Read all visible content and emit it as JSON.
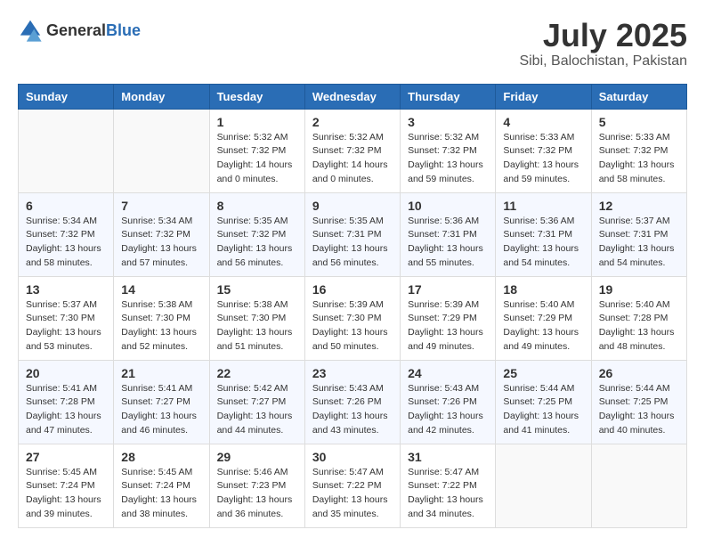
{
  "header": {
    "logo_general": "General",
    "logo_blue": "Blue",
    "month_title": "July 2025",
    "location": "Sibi, Balochistan, Pakistan"
  },
  "weekdays": [
    "Sunday",
    "Monday",
    "Tuesday",
    "Wednesday",
    "Thursday",
    "Friday",
    "Saturday"
  ],
  "weeks": [
    [
      {
        "day": "",
        "empty": true
      },
      {
        "day": "",
        "empty": true
      },
      {
        "day": "1",
        "sunrise": "Sunrise: 5:32 AM",
        "sunset": "Sunset: 7:32 PM",
        "daylight": "Daylight: 14 hours and 0 minutes."
      },
      {
        "day": "2",
        "sunrise": "Sunrise: 5:32 AM",
        "sunset": "Sunset: 7:32 PM",
        "daylight": "Daylight: 14 hours and 0 minutes."
      },
      {
        "day": "3",
        "sunrise": "Sunrise: 5:32 AM",
        "sunset": "Sunset: 7:32 PM",
        "daylight": "Daylight: 13 hours and 59 minutes."
      },
      {
        "day": "4",
        "sunrise": "Sunrise: 5:33 AM",
        "sunset": "Sunset: 7:32 PM",
        "daylight": "Daylight: 13 hours and 59 minutes."
      },
      {
        "day": "5",
        "sunrise": "Sunrise: 5:33 AM",
        "sunset": "Sunset: 7:32 PM",
        "daylight": "Daylight: 13 hours and 58 minutes."
      }
    ],
    [
      {
        "day": "6",
        "sunrise": "Sunrise: 5:34 AM",
        "sunset": "Sunset: 7:32 PM",
        "daylight": "Daylight: 13 hours and 58 minutes."
      },
      {
        "day": "7",
        "sunrise": "Sunrise: 5:34 AM",
        "sunset": "Sunset: 7:32 PM",
        "daylight": "Daylight: 13 hours and 57 minutes."
      },
      {
        "day": "8",
        "sunrise": "Sunrise: 5:35 AM",
        "sunset": "Sunset: 7:32 PM",
        "daylight": "Daylight: 13 hours and 56 minutes."
      },
      {
        "day": "9",
        "sunrise": "Sunrise: 5:35 AM",
        "sunset": "Sunset: 7:31 PM",
        "daylight": "Daylight: 13 hours and 56 minutes."
      },
      {
        "day": "10",
        "sunrise": "Sunrise: 5:36 AM",
        "sunset": "Sunset: 7:31 PM",
        "daylight": "Daylight: 13 hours and 55 minutes."
      },
      {
        "day": "11",
        "sunrise": "Sunrise: 5:36 AM",
        "sunset": "Sunset: 7:31 PM",
        "daylight": "Daylight: 13 hours and 54 minutes."
      },
      {
        "day": "12",
        "sunrise": "Sunrise: 5:37 AM",
        "sunset": "Sunset: 7:31 PM",
        "daylight": "Daylight: 13 hours and 54 minutes."
      }
    ],
    [
      {
        "day": "13",
        "sunrise": "Sunrise: 5:37 AM",
        "sunset": "Sunset: 7:30 PM",
        "daylight": "Daylight: 13 hours and 53 minutes."
      },
      {
        "day": "14",
        "sunrise": "Sunrise: 5:38 AM",
        "sunset": "Sunset: 7:30 PM",
        "daylight": "Daylight: 13 hours and 52 minutes."
      },
      {
        "day": "15",
        "sunrise": "Sunrise: 5:38 AM",
        "sunset": "Sunset: 7:30 PM",
        "daylight": "Daylight: 13 hours and 51 minutes."
      },
      {
        "day": "16",
        "sunrise": "Sunrise: 5:39 AM",
        "sunset": "Sunset: 7:30 PM",
        "daylight": "Daylight: 13 hours and 50 minutes."
      },
      {
        "day": "17",
        "sunrise": "Sunrise: 5:39 AM",
        "sunset": "Sunset: 7:29 PM",
        "daylight": "Daylight: 13 hours and 49 minutes."
      },
      {
        "day": "18",
        "sunrise": "Sunrise: 5:40 AM",
        "sunset": "Sunset: 7:29 PM",
        "daylight": "Daylight: 13 hours and 49 minutes."
      },
      {
        "day": "19",
        "sunrise": "Sunrise: 5:40 AM",
        "sunset": "Sunset: 7:28 PM",
        "daylight": "Daylight: 13 hours and 48 minutes."
      }
    ],
    [
      {
        "day": "20",
        "sunrise": "Sunrise: 5:41 AM",
        "sunset": "Sunset: 7:28 PM",
        "daylight": "Daylight: 13 hours and 47 minutes."
      },
      {
        "day": "21",
        "sunrise": "Sunrise: 5:41 AM",
        "sunset": "Sunset: 7:27 PM",
        "daylight": "Daylight: 13 hours and 46 minutes."
      },
      {
        "day": "22",
        "sunrise": "Sunrise: 5:42 AM",
        "sunset": "Sunset: 7:27 PM",
        "daylight": "Daylight: 13 hours and 44 minutes."
      },
      {
        "day": "23",
        "sunrise": "Sunrise: 5:43 AM",
        "sunset": "Sunset: 7:26 PM",
        "daylight": "Daylight: 13 hours and 43 minutes."
      },
      {
        "day": "24",
        "sunrise": "Sunrise: 5:43 AM",
        "sunset": "Sunset: 7:26 PM",
        "daylight": "Daylight: 13 hours and 42 minutes."
      },
      {
        "day": "25",
        "sunrise": "Sunrise: 5:44 AM",
        "sunset": "Sunset: 7:25 PM",
        "daylight": "Daylight: 13 hours and 41 minutes."
      },
      {
        "day": "26",
        "sunrise": "Sunrise: 5:44 AM",
        "sunset": "Sunset: 7:25 PM",
        "daylight": "Daylight: 13 hours and 40 minutes."
      }
    ],
    [
      {
        "day": "27",
        "sunrise": "Sunrise: 5:45 AM",
        "sunset": "Sunset: 7:24 PM",
        "daylight": "Daylight: 13 hours and 39 minutes."
      },
      {
        "day": "28",
        "sunrise": "Sunrise: 5:45 AM",
        "sunset": "Sunset: 7:24 PM",
        "daylight": "Daylight: 13 hours and 38 minutes."
      },
      {
        "day": "29",
        "sunrise": "Sunrise: 5:46 AM",
        "sunset": "Sunset: 7:23 PM",
        "daylight": "Daylight: 13 hours and 36 minutes."
      },
      {
        "day": "30",
        "sunrise": "Sunrise: 5:47 AM",
        "sunset": "Sunset: 7:22 PM",
        "daylight": "Daylight: 13 hours and 35 minutes."
      },
      {
        "day": "31",
        "sunrise": "Sunrise: 5:47 AM",
        "sunset": "Sunset: 7:22 PM",
        "daylight": "Daylight: 13 hours and 34 minutes."
      },
      {
        "day": "",
        "empty": true
      },
      {
        "day": "",
        "empty": true
      }
    ]
  ]
}
